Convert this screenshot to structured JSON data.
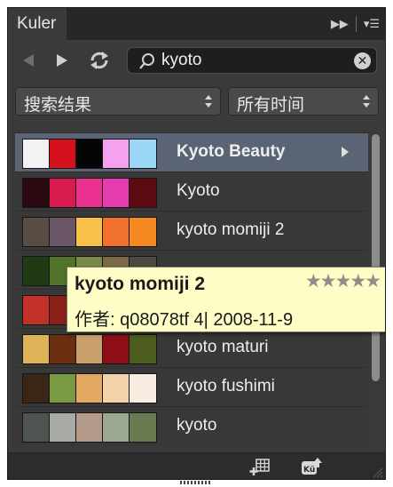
{
  "panel": {
    "tab_title": "Kuler",
    "menu_icons": [
      "fast-forward-icon",
      "panel-menu-icon"
    ]
  },
  "toolbar": {
    "search_value": "kyoto",
    "icons": [
      "back-arrow-icon",
      "forward-arrow-icon",
      "refresh-icon",
      "search-icon",
      "clear-icon"
    ]
  },
  "filters": {
    "result_type": "搜索结果",
    "time_range": "所有时间"
  },
  "themes": [
    {
      "name": "Kyoto Beauty",
      "selected": true,
      "colors": [
        "#f2f2f2",
        "#d6101c",
        "#050505",
        "#f4a1ee",
        "#9ad6f5"
      ]
    },
    {
      "name": "Kyoto",
      "selected": false,
      "colors": [
        "#2a0a10",
        "#d81a4e",
        "#e9308f",
        "#e43cae",
        "#5e0a12"
      ]
    },
    {
      "name": "kyoto momiji 2",
      "selected": false,
      "colors": [
        "#5a4c44",
        "#6b5666",
        "#f7c049",
        "#f0702d",
        "#f58a23"
      ]
    },
    {
      "name": "",
      "selected": false,
      "colors": [
        "#203b13",
        "#50742a",
        "#7a8a48",
        "#7a6a48",
        "#4a4a40"
      ]
    },
    {
      "name": "",
      "selected": false,
      "colors": [
        "#c2302a",
        "#8a2018",
        "#6a2a20",
        "#7a3a28",
        "#5a3a2c"
      ]
    },
    {
      "name": "kyoto maturi",
      "selected": false,
      "colors": [
        "#dcb457",
        "#6b2e0e",
        "#c9a06a",
        "#8e0e17",
        "#4d5d1d"
      ]
    },
    {
      "name": "kyoto fushimi",
      "selected": false,
      "colors": [
        "#3a2616",
        "#7a9a44",
        "#e2a860",
        "#f2d2aa",
        "#f6ece0"
      ]
    },
    {
      "name": "kyoto",
      "selected": false,
      "colors": [
        "#4e5450",
        "#a8aaa6",
        "#b49a88",
        "#9aa890",
        "#6a7a50"
      ]
    }
  ],
  "tooltip": {
    "title": "kyoto momiji 2",
    "stars": "★★★★★",
    "meta": "作者: q08078tf 4| 2008-11-9"
  },
  "bottombar": {
    "icons": [
      "add-to-swatches-icon",
      "upload-icon"
    ]
  }
}
